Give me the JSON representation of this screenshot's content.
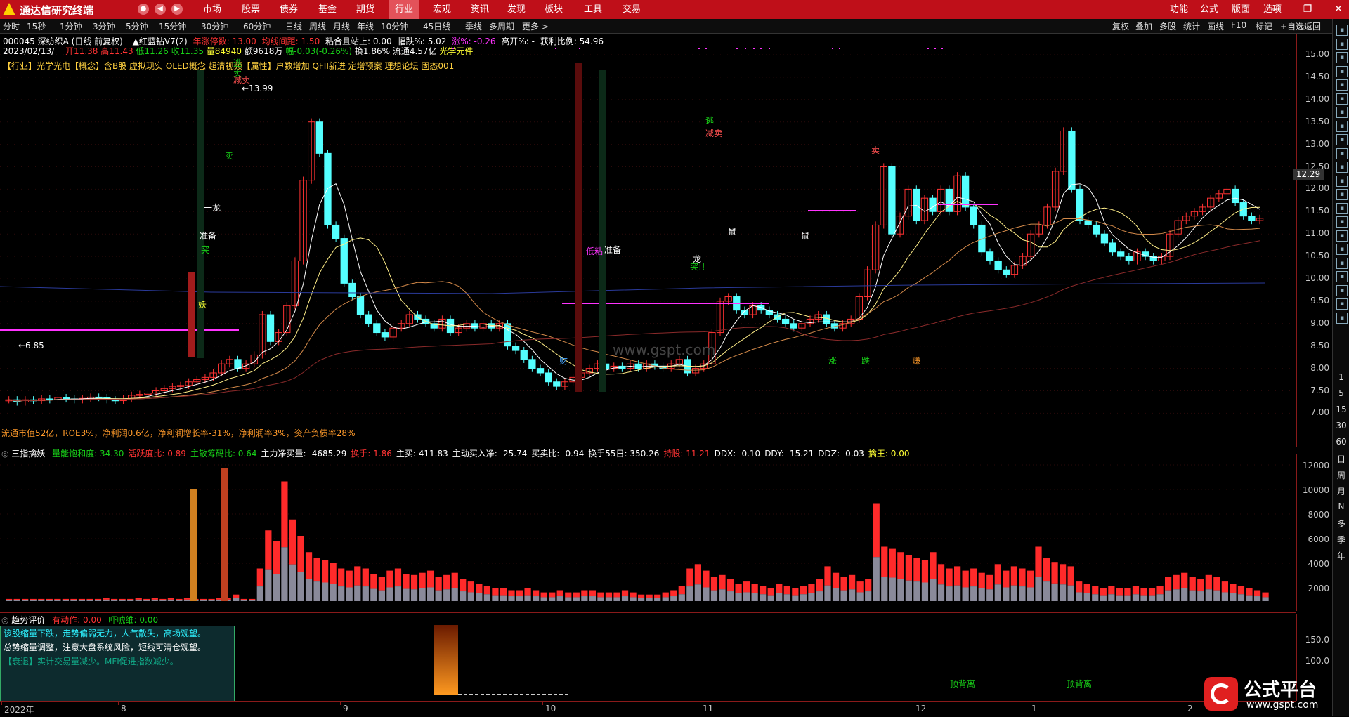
{
  "app": {
    "title": "通达信研究终端",
    "menus": [
      "市场",
      "股票",
      "债券",
      "基金",
      "期货",
      "行业",
      "宏观",
      "资讯",
      "发现",
      "板块",
      "工具",
      "交易"
    ],
    "active_menu": "行业",
    "right_menus": [
      "功能",
      "公式",
      "版面",
      "选项"
    ]
  },
  "periods": [
    "分时",
    "15秒",
    "1分钟",
    "3分钟",
    "5分钟",
    "15分钟",
    "30分钟",
    "60分钟",
    "日线",
    "周线",
    "月线",
    "年线",
    "10分钟",
    "45日线",
    "季线",
    "多周期",
    "更多 >"
  ],
  "tools": [
    "复权",
    "叠加",
    "多股",
    "统计",
    "画线",
    "F10",
    "标记",
    "+自选",
    "返回"
  ],
  "stock": {
    "code_line": "000045 深纺织A (日线 前复权)",
    "indicator_name": "▲红蓝钻V7(2)",
    "limit_label": "年涨停数:",
    "limit_val": "13.00",
    "ma_gap": "均线间距: 1.50",
    "stick": "粘合且站上: 0.00",
    "amp": "幅跌%: 5.02",
    "chg": "涨%: -0.26",
    "open": "高开%: -",
    "profit": "获利比例: 54.96",
    "date": "2023/02/13/一",
    "o": "开11.38",
    "h": "高11.43",
    "l": "低11.26",
    "c": "收11.35",
    "vol": "量84940",
    "amt": "额9618万",
    "chg2": "幅-0.03(-0.26%)",
    "turnover": "换1.86%",
    "float": "流通4.57亿",
    "sector": "光学元件",
    "tags_line": "【行业】光学光电【概念】含B股 虚拟现实 OLED概念 超清视频【属性】户数增加 QFII新进 定增预案 理想论坛 固态001",
    "fund_line": "流通市值52亿，ROE3%，净利润0.6亿，净利润增长率-31%，净利润率3%，资产负债率28%",
    "hi_label": "13.99",
    "lo_label": "6.85",
    "price_tag": "12.29",
    "watermark": "www.gspt.com"
  },
  "annotations": {
    "flee": "逃",
    "sell": "卖",
    "reduce": "减卖",
    "dragon": "一龙",
    "prepare": "准备",
    "break": "突",
    "demon": "妖",
    "lowstick": "低粘",
    "rat": "鼠",
    "dragon2": "龙",
    "break2": "突!!",
    "fin": "财",
    "drop": "跌",
    "up": "涨",
    "fall": "跌",
    "gain": "赚"
  },
  "vol_panel": {
    "name": "三指擒妖",
    "items": [
      {
        "t": "量能饱和度: 34.30",
        "c": "#18d018"
      },
      {
        "t": "活跃度比: 0.89",
        "c": "#ff3333"
      },
      {
        "t": "主散筹码比: 0.64",
        "c": "#18d018"
      },
      {
        "t": "主力净买量: -4685.29",
        "c": "#ffffff"
      },
      {
        "t": "换手: 1.86",
        "c": "#ff3333"
      },
      {
        "t": "主买: 411.83",
        "c": "#ffffff"
      },
      {
        "t": "主动买入净: -25.74",
        "c": "#ffffff"
      },
      {
        "t": "买卖比: -0.94",
        "c": "#ffffff"
      },
      {
        "t": "换手55日: 350.26",
        "c": "#ffffff"
      },
      {
        "t": "持股: 11.21",
        "c": "#ff3333"
      },
      {
        "t": "DDX: -0.10",
        "c": "#ffffff"
      },
      {
        "t": "DDY: -15.21",
        "c": "#ffffff"
      },
      {
        "t": "DDZ: -0.03",
        "c": "#ffffff"
      },
      {
        "t": "擒王: 0.00",
        "c": "#ffff33"
      }
    ],
    "axis": [
      "12000",
      "10000",
      "8000",
      "6000",
      "4000",
      "2000"
    ]
  },
  "trend_panel": {
    "name": "趋势评价",
    "item1": "有动作: 0.00",
    "item2": "吓唬维: 0.00",
    "note1": "该股缩量下跌，走势偏弱无力，人气散失，高场观望。",
    "note2": "总势缩量调整，注意大盘系统风险，短线可清仓观望。",
    "note3": "【衰退】实计交易量减少。MFI促进指数减少。",
    "div1": "顶背离",
    "div2": "顶背离",
    "axis": [
      "150.0",
      "100.0"
    ]
  },
  "price_axis": [
    "15.00",
    "14.50",
    "14.00",
    "13.50",
    "13.00",
    "12.50",
    "12.00",
    "11.50",
    "11.00",
    "10.50",
    "10.00",
    "9.50",
    "9.00",
    "8.50",
    "8.00",
    "7.50",
    "7.00"
  ],
  "xaxis": [
    "2022年",
    "8",
    "9",
    "10",
    "11",
    "12",
    "1",
    "2"
  ],
  "right_labels": [
    "1",
    "5",
    "15",
    "30",
    "60",
    "日",
    "周",
    "月",
    "N",
    "多",
    "季",
    "年"
  ],
  "brand": "公式平台",
  "brand_url": "www.gspt.com"
}
